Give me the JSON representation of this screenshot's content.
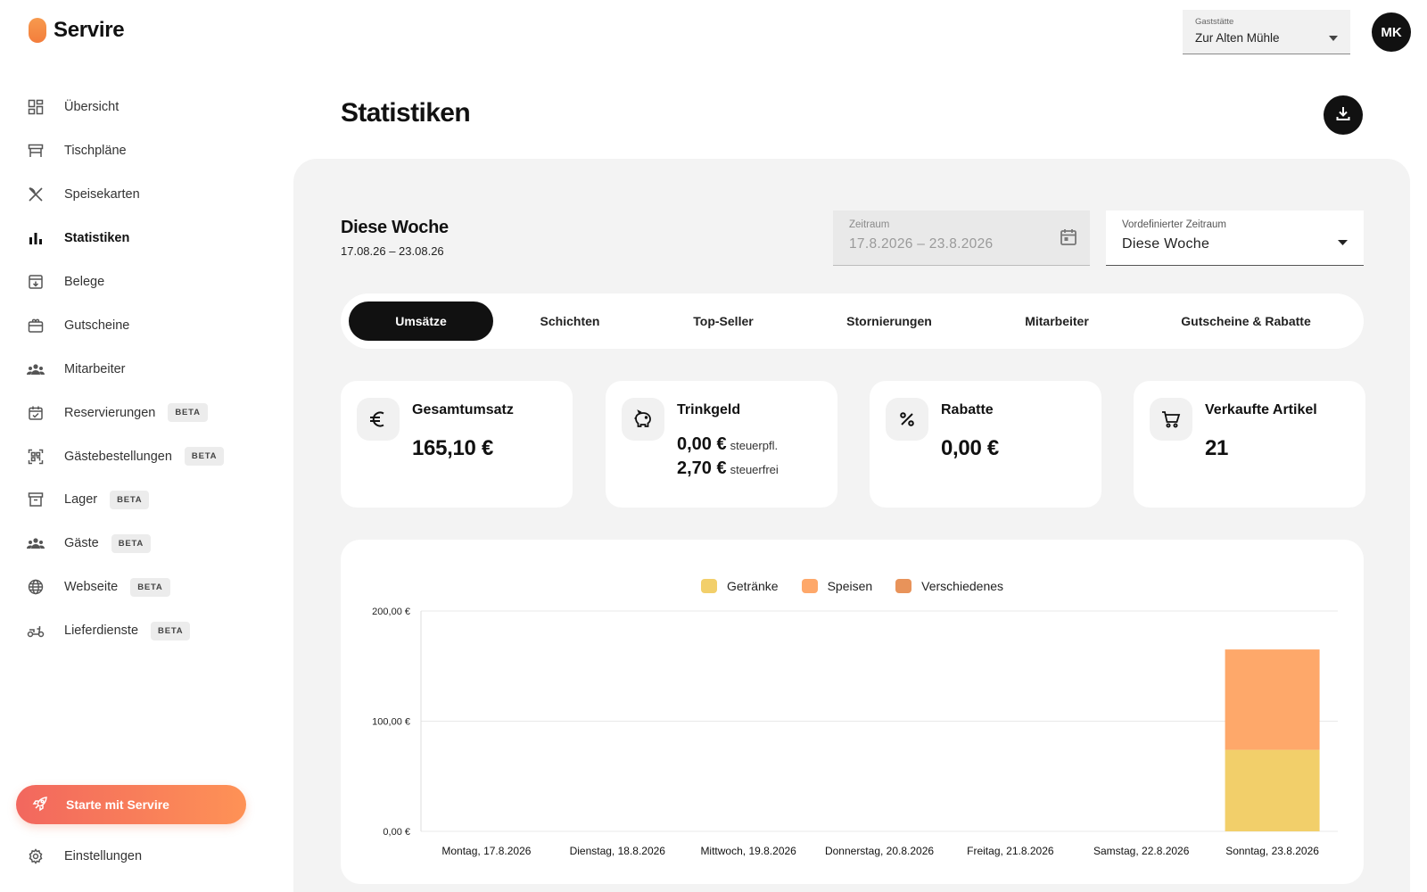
{
  "brand": {
    "name": "Servire"
  },
  "header": {
    "venue_label": "Gaststätte",
    "venue_value": "Zur Alten Mühle",
    "avatar_initials": "MK",
    "page_title": "Statistiken"
  },
  "sidebar": {
    "items": [
      {
        "label": "Übersicht",
        "icon": "dashboard-icon",
        "active": false
      },
      {
        "label": "Tischpläne",
        "icon": "table-icon",
        "active": false
      },
      {
        "label": "Speisekarten",
        "icon": "cutlery-icon",
        "active": false
      },
      {
        "label": "Statistiken",
        "icon": "bar-chart-icon",
        "active": true
      },
      {
        "label": "Belege",
        "icon": "receipt-box-icon",
        "active": false
      },
      {
        "label": "Gutscheine",
        "icon": "gift-card-icon",
        "active": false
      },
      {
        "label": "Mitarbeiter",
        "icon": "team-icon",
        "active": false
      },
      {
        "label": "Reservierungen",
        "icon": "calendar-check-icon",
        "active": false,
        "badge": "BETA"
      },
      {
        "label": "Gästebestellungen",
        "icon": "qr-code-icon",
        "active": false,
        "badge": "BETA"
      },
      {
        "label": "Lager",
        "icon": "archive-icon",
        "active": false,
        "badge": "BETA"
      },
      {
        "label": "Gäste",
        "icon": "guests-icon",
        "active": false,
        "badge": "BETA"
      },
      {
        "label": "Webseite",
        "icon": "globe-icon",
        "active": false,
        "badge": "BETA"
      },
      {
        "label": "Lieferdienste",
        "icon": "scooter-icon",
        "active": false,
        "badge": "BETA"
      }
    ],
    "start_label": "Starte mit Servire",
    "settings_label": "Einstellungen"
  },
  "range": {
    "title": "Diese Woche",
    "dates": "17.08.26 – 23.08.26",
    "zeitraum_label": "Zeitraum",
    "zeitraum_value": "17.8.2026 – 23.8.2026",
    "preset_label": "Vordefinierter Zeitraum",
    "preset_value": "Diese Woche"
  },
  "tabs": [
    {
      "label": "Umsätze",
      "active": true
    },
    {
      "label": "Schichten",
      "active": false
    },
    {
      "label": "Top-Seller",
      "active": false
    },
    {
      "label": "Stornierungen",
      "active": false
    },
    {
      "label": "Mitarbeiter",
      "active": false
    },
    {
      "label": "Gutscheine & Rabatte",
      "active": false
    }
  ],
  "kpis": {
    "revenue": {
      "title": "Gesamtumsatz",
      "value": "165,10 €",
      "icon": "euro-icon"
    },
    "tips": {
      "title": "Trinkgeld",
      "taxable_value": "0,00 €",
      "taxable_label": "steuerpfl.",
      "taxfree_value": "2,70 €",
      "taxfree_label": "steuerfrei",
      "icon": "piggy-bank-icon"
    },
    "discounts": {
      "title": "Rabatte",
      "value": "0,00 €",
      "icon": "percent-icon"
    },
    "items_sold": {
      "title": "Verkaufte Artikel",
      "value": "21",
      "icon": "shopping-cart-icon"
    }
  },
  "colors": {
    "accent_start": "#f2675e",
    "accent_end": "#fe9256",
    "getraenke": "#f2cf6a",
    "speisen": "#fea86a",
    "verschiedenes": "#e8935a"
  },
  "chart_data": {
    "type": "bar",
    "stacked": true,
    "categories": [
      "Montag, 17.8.2026",
      "Dienstag, 18.8.2026",
      "Mittwoch, 19.8.2026",
      "Donnerstag, 20.8.2026",
      "Freitag, 21.8.2026",
      "Samstag, 22.8.2026",
      "Sonntag, 23.8.2026"
    ],
    "series": [
      {
        "name": "Getränke",
        "values": [
          0,
          0,
          0,
          0,
          0,
          0,
          74
        ]
      },
      {
        "name": "Speisen",
        "values": [
          0,
          0,
          0,
          0,
          0,
          0,
          91.1
        ]
      },
      {
        "name": "Verschiedenes",
        "values": [
          0,
          0,
          0,
          0,
          0,
          0,
          0
        ]
      }
    ],
    "yticks": [
      "200,00 €",
      "100,00 €",
      "0,00 €"
    ],
    "ylim": [
      0,
      200
    ],
    "grid": true,
    "legend_position": "top-center"
  }
}
